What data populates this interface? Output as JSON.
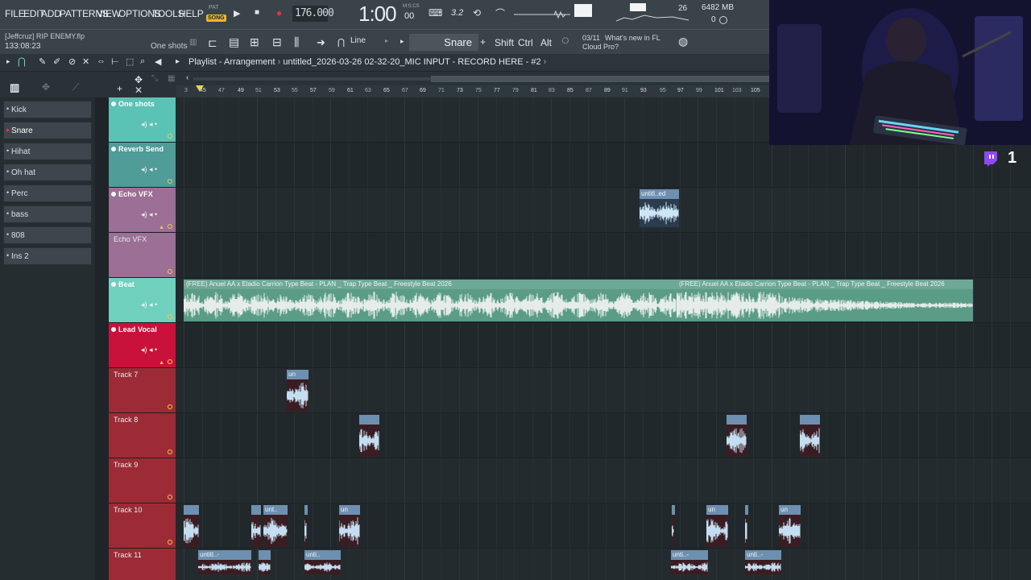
{
  "menu": [
    "FILE",
    "EDIT",
    "ADD",
    "PATTERNS",
    "VIEW",
    "OPTIONS",
    "TOOLS",
    "HELP"
  ],
  "transport": {
    "pat_label": "PAT",
    "song_label": "SONG",
    "tempo": "176.000",
    "time": "1:00",
    "time_sub": "00",
    "time_msc": "M:S:CS",
    "snap_value": "3.2",
    "pattern_display": "26",
    "memory": "6482 MB",
    "poly": "0"
  },
  "project": {
    "file": "[Jeffcruz] RIP ENEMY.flp",
    "elapsed": "133:08:23",
    "hint": "One shots"
  },
  "toolbar2": {
    "snap_mode": "Line",
    "channel": "Snare",
    "keys": [
      "Shift",
      "Ctrl",
      "Alt"
    ],
    "news_date": "03/11",
    "news_title_line1": "What's new in FL",
    "news_title_line2": "Cloud Pro?"
  },
  "playlist": {
    "title_prefix": "Playlist - Arrangement",
    "pattern": "untitled_2026-03-26 02-32-20_MIC INPUT - RECORD HERE - #2",
    "ticks": [
      "3",
      "45",
      "47",
      "49",
      "51",
      "53",
      "55",
      "57",
      "59",
      "61",
      "63",
      "65",
      "67",
      "69",
      "71",
      "73",
      "75",
      "77",
      "79",
      "81",
      "83",
      "85",
      "87",
      "89",
      "91",
      "93",
      "95",
      "97",
      "99",
      "101",
      "103",
      "105"
    ]
  },
  "picker": [
    "Kick",
    "Snare",
    "Hihat",
    "Oh hat",
    "Perc",
    "bass",
    "808",
    "Ins 2"
  ],
  "tracks": [
    {
      "name": "One shots",
      "color": "#5bc2b6"
    },
    {
      "name": "Reverb Send",
      "color": "#4f9c99"
    },
    {
      "name": "Echo VFX",
      "color": "#9b6f96"
    },
    {
      "name": "Echo VFX",
      "color": "#9b6f96"
    },
    {
      "name": "Beat",
      "color": "#6fd0bd"
    },
    {
      "name": "Lead Vocal",
      "color": "#c8123b"
    },
    {
      "name": "Track 7",
      "color": "#9c2b35"
    },
    {
      "name": "Track 8",
      "color": "#9c2b35"
    },
    {
      "name": "Track 9",
      "color": "#9c2b35"
    },
    {
      "name": "Track 10",
      "color": "#9c2b35"
    },
    {
      "name": "Track 11",
      "color": "#9c2b35"
    }
  ],
  "clips": {
    "echo": "untitl..ed",
    "beat_a": "(FREE) Anuel AA x Eladio Carrion Type Beat - PLAN _ Trap Type Beat _ Freestyle  Beat 2026",
    "beat_b": "(FREE) Anuel AA x Eladio Carrion Type Beat - PLAN _ Trap Type Beat _ Freestyle  Beat 2026",
    "short": "un",
    "short2": "unt..",
    "mid": "untitl..-",
    "mid2": "unti..",
    "mid3": "unti..-",
    "none": ""
  },
  "twitch_count": "1"
}
